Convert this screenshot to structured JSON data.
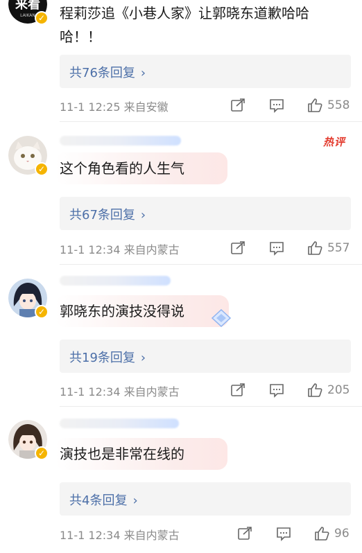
{
  "comments": [
    {
      "avatar": "laikan-logo-avatar",
      "text_line1": "程莉莎追《小巷人家》让郭晓东道歉哈哈",
      "text_line2": "哈！！",
      "replies": "共76条回复",
      "meta": "11-1 12:25 来自安徽",
      "likes": "558"
    },
    {
      "avatar": "white-cat-avatar",
      "hot_label": "热评",
      "text_line1": "这个角色看的人生气",
      "replies": "共67条回复",
      "meta": "11-1 12:34 来自内蒙古",
      "likes": "557"
    },
    {
      "avatar": "anime-girl-avatar",
      "text_line1": "郭晓东的演技没得说",
      "replies": "共19条回复",
      "meta": "11-1 12:34 来自内蒙古",
      "likes": "205"
    },
    {
      "avatar": "anime-girl-brown-hair-avatar",
      "text_line1": "演技也是非常在线的",
      "replies": "共4条回复",
      "meta": "11-1 12:34 来自内蒙古",
      "likes": "96"
    }
  ],
  "avatar_logo_text": "来看",
  "avatar_logo_subtext": "LAIKAN",
  "icons": [
    "share-icon",
    "comment-icon",
    "like-icon",
    "chevron-right-icon",
    "verified-badge-icon"
  ],
  "colors": {
    "reply_link": "#4c6fa8",
    "meta": "#8a8a8a",
    "hot": "#e33b2e",
    "badge": "#f5b400"
  }
}
